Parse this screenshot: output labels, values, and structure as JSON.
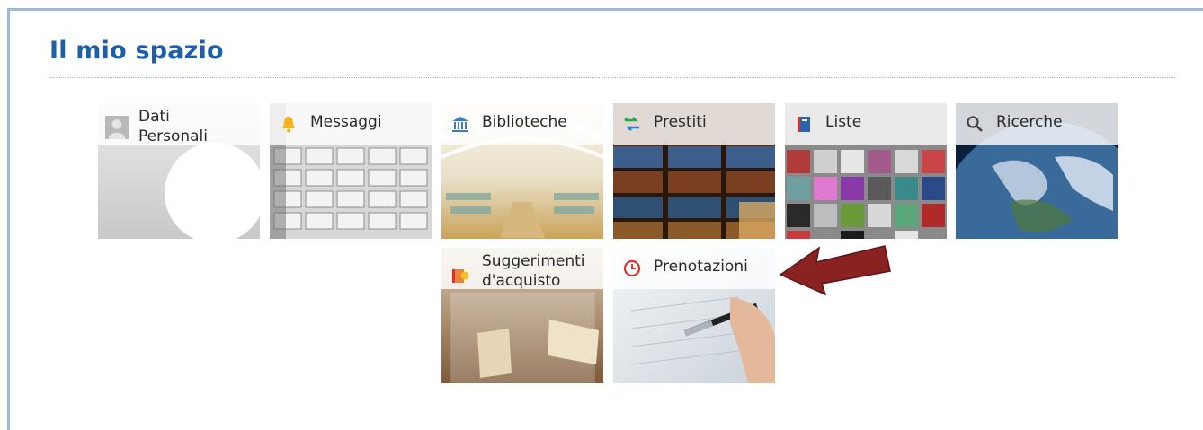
{
  "page": {
    "title": "Il mio spazio"
  },
  "tiles": [
    {
      "line1": "Dati",
      "line2": "Personali",
      "icon": "user-icon"
    },
    {
      "line1": "Messaggi",
      "icon": "bell-icon"
    },
    {
      "line1": "Biblioteche",
      "icon": "library-icon"
    },
    {
      "line1": "Prestiti",
      "icon": "exchange-icon"
    },
    {
      "line1": "Liste",
      "icon": "list-icon"
    },
    {
      "line1": "Ricerche",
      "icon": "search-icon"
    },
    {
      "line1": "Suggerimenti",
      "line2": "d'acquisto",
      "icon": "suggestion-icon"
    },
    {
      "line1": "Prenotazioni",
      "icon": "clock-icon"
    }
  ],
  "colors": {
    "title": "#1f5fa8",
    "arrow": "#8b2222",
    "frame": "#9cb9da"
  }
}
